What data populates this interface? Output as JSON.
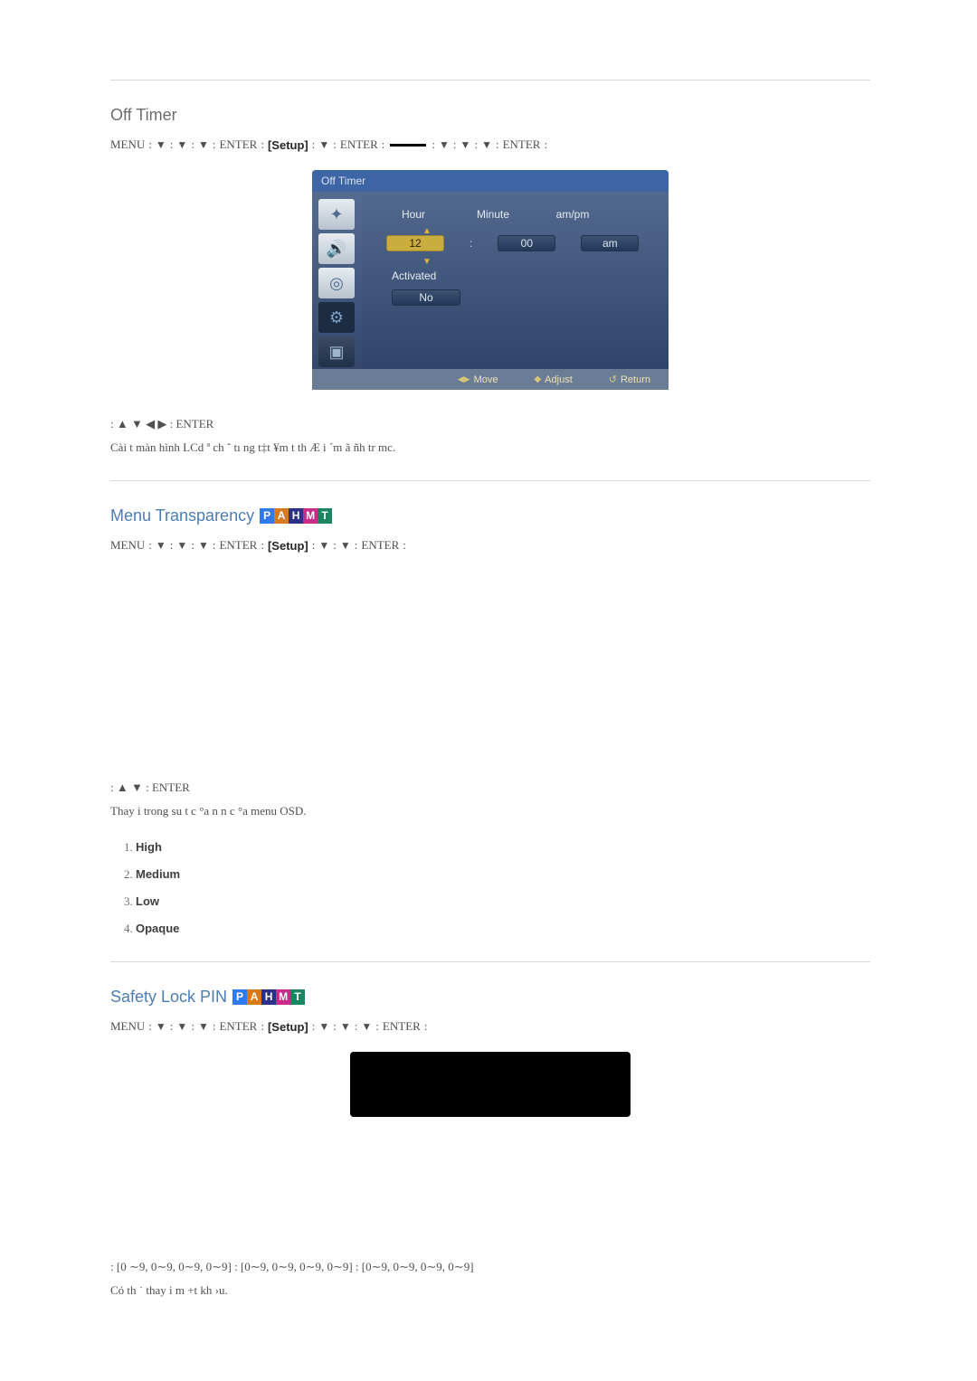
{
  "sec1": {
    "title": "Off Timer",
    "menu_path": {
      "menu": "MENU",
      "enter": "ENTER",
      "setup": "[Setup]"
    },
    "osd": {
      "title": "Off Timer",
      "labels": {
        "hour": "Hour",
        "minute": "Minute",
        "ampm": "am/pm"
      },
      "values": {
        "hour": "12",
        "minute": "00",
        "ampm": "am"
      },
      "activated_label": "Activated",
      "activated_value": "No",
      "bottom": {
        "move": "Move",
        "adjust": "Adjust",
        "return": "Return"
      }
    },
    "ctrl_line": ": ▲ ▼ ◀ ▶ : ENTER",
    "desc": "Cài t màn hình LCd ª ch ˜  tı  ng t‡t ¥m t th Æ i ´m  ã  ñh tr mc."
  },
  "sec2": {
    "title": "Menu Transparency",
    "menu_path": {
      "menu": "MENU",
      "enter": "ENTER",
      "setup": "[Setup]"
    },
    "ctrl_line": ": ▲ ▼ : ENTER",
    "desc": "Thay  i  trong su t c °a n n c °a menu OSD.",
    "options": [
      "High",
      "Medium",
      "Low",
      "Opaque"
    ]
  },
  "sec3": {
    "title": "Safety Lock PIN",
    "menu_path": {
      "menu": "MENU",
      "enter": "ENTER",
      "setup": "[Setup]"
    },
    "pin_line": ": [0 ∼9, 0∼9, 0∼9, 0∼9] : [0∼9, 0∼9, 0∼9, 0∼9] : [0∼9, 0∼9, 0∼9, 0∼9]",
    "desc": "Có th ˙ thay  i m +t kh ›u."
  },
  "arrows": {
    "down": "▼",
    "up": "▲",
    "left": "◀",
    "right": "▶"
  },
  "colon": ":",
  "pahmt": {
    "P": "P",
    "A": "A",
    "H": "H",
    "M": "M",
    "T": "T"
  }
}
